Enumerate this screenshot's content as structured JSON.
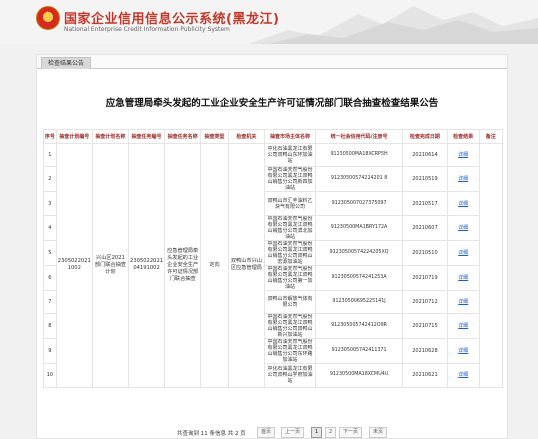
{
  "header": {
    "title": "国家企业信用信息公示系统(黑龙江)",
    "subtitle": "National Enterprise Credit Information Publicity System"
  },
  "tab": {
    "label": "检查结果公告"
  },
  "page_title": "应急管理局牵头发起的工业企业安全生产许可证情况部门联合抽查检查结果公告",
  "table": {
    "headers": [
      "序号",
      "抽查计划编号",
      "抽查计划名称",
      "抽查任务编号",
      "抽查任务名称",
      "抽查类型",
      "检查机关",
      "抽查市场主体名称",
      "统一社会信用代码/注册号",
      "检查完成日期",
      "检查结果",
      "备注"
    ],
    "merged": {
      "plan_no": "2305022021 1002",
      "plan_name": "兴山区2021部门联合抽查计划",
      "task_no": "2305022021 04191002",
      "task_name": "应急管理局牵头发起的工业企业安全生产许可证情况部门联合抽查",
      "type": "定向",
      "agency": "双鸭山市兴山区应急管理局"
    },
    "rows": [
      {
        "no": "1",
        "name": "中化石油黑龙江有限公司双鸭山东环加油站",
        "code": "91230500MA18XCRP5H",
        "date": "20210614",
        "result": "详细"
      },
      {
        "no": "2",
        "name": "中国石油天然气股份有限公司黑龙江双鸭山销售分公司新四加油站",
        "code": "91230500574224201 8",
        "date": "20210519",
        "result": "详细"
      },
      {
        "no": "3",
        "name": "双鸭山市汇丰油料乙炔气有限公司",
        "code": "912305007027375097",
        "date": "20210517",
        "result": "详细"
      },
      {
        "no": "4",
        "name": "中国石油天然气股份有限公司黑龙江双鸭山销售分公司滨北加油站",
        "code": "91230500MA1BRY172A",
        "date": "20210607",
        "result": "详细"
      },
      {
        "no": "5",
        "name": "中国石油天然气股份有限公司黑龙江双鸭山销售分公司双鸭山宏源加油站",
        "code": "91230500574224205XQ",
        "date": "20210510",
        "result": "详细"
      },
      {
        "no": "6",
        "name": "中国石油天然气股份有限公司黑龙江双鸭山销售分公司第一加油站",
        "code": "91230500574241253A",
        "date": "20210719",
        "result": "详细"
      },
      {
        "no": "7",
        "name": "双鸭山市解放气体有限公司",
        "code": "91230500695225141J",
        "date": "20210712",
        "result": "详细"
      },
      {
        "no": "8",
        "name": "中国石油天然气股份有限公司黑龙江双鸭山销售分公司双鸭山新兴加油站",
        "code": "912305005742412O9R",
        "date": "20210715",
        "result": "详细"
      },
      {
        "no": "9",
        "name": "中国石油天然气股份有限公司黑龙江双鸭山销售分公司东环路加油站",
        "code": "912305005742411371",
        "date": "20210628",
        "result": "详细"
      },
      {
        "no": "10",
        "name": "中化石油黑龙江有限公司双鸭山学府加油站",
        "code": "91230500MA18XCMU4U",
        "date": "20210621",
        "result": "详细"
      }
    ]
  },
  "pager": {
    "info": "共查询到 11 条信息  共 2 页",
    "first": "首页",
    "prev": "上一页",
    "pages": [
      "1",
      "2"
    ],
    "next": "下一页",
    "last": "末页"
  },
  "colors": {
    "brand_red": "#c0392b",
    "header_text": "#9b2a2a",
    "link": "#1d5fc4"
  }
}
